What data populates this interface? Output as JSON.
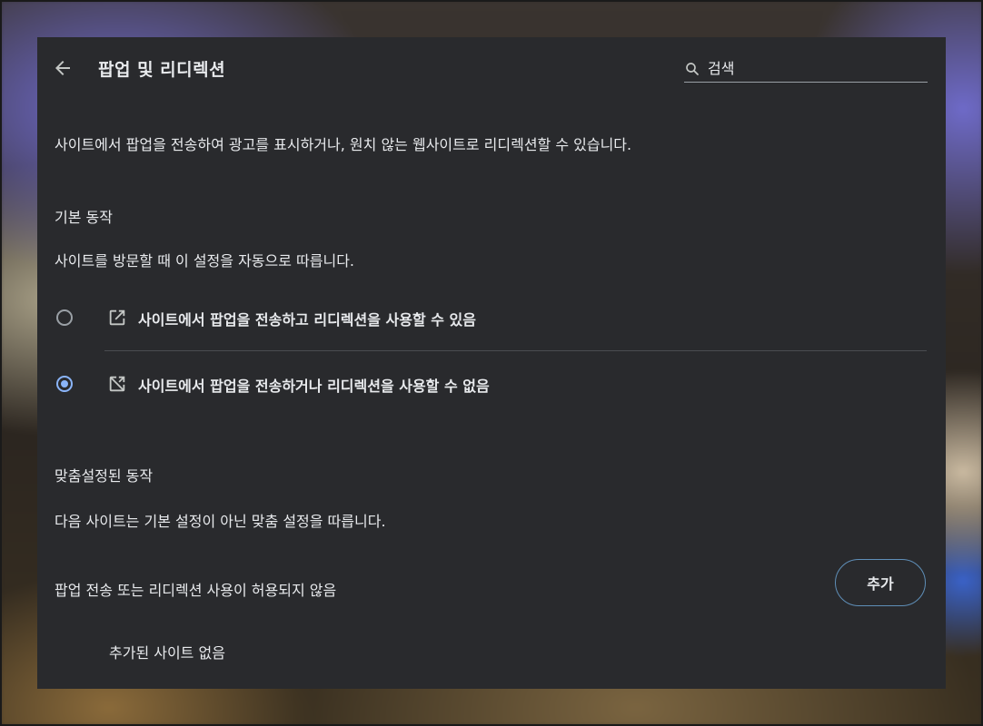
{
  "header": {
    "title": "팝업 및 리디렉션",
    "search_placeholder": "검색"
  },
  "description": "사이트에서 팝업을 전송하여 광고를 표시하거나, 원치 않는 웹사이트로 리디렉션할 수 있습니다.",
  "default_behavior": {
    "heading": "기본 동작",
    "subtitle": "사이트를 방문할 때 이 설정을 자동으로 따릅니다.",
    "options": [
      {
        "label": "사이트에서 팝업을 전송하고 리디렉션을 사용할 수 있음",
        "icon": "open-in-new-icon",
        "selected": false
      },
      {
        "label": "사이트에서 팝업을 전송하거나 리디렉션을 사용할 수 없음",
        "icon": "popup-blocked-icon",
        "selected": true
      }
    ]
  },
  "custom_behavior": {
    "heading": "맞춤설정된 동작",
    "subtitle": "다음 사이트는 기본 설정이 아닌 맞춤 설정을 따릅니다.",
    "blocked_list_title": "팝업 전송 또는 리디렉션 사용이 허용되지 않음",
    "add_button": "추가",
    "empty_text": "추가된 사이트 없음"
  },
  "colors": {
    "panel_bg": "#292a2d",
    "text": "#e8eaed",
    "accent": "#8ab4f8"
  }
}
